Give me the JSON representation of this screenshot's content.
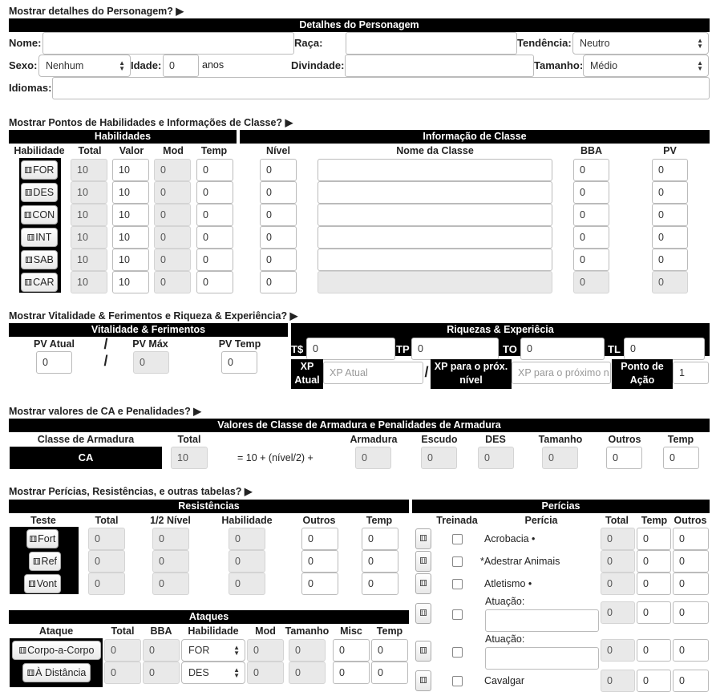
{
  "sections": {
    "details_toggle": "Mostrar detalhes do Personagem?",
    "abilities_toggle": "Mostrar Pontos de Habilidades e Informações de Classe?",
    "vitality_toggle": "Mostrar Vitalidade & Ferimentos e Riqueza & Experiência?",
    "ac_toggle": "Mostrar valores de CA e Penalidades?",
    "skills_toggle": "Mostrar Perícias, Resistências, e outras tabelas?"
  },
  "details": {
    "title": "Detalhes do Personagem",
    "name_label": "Nome:",
    "race_label": "Raça:",
    "alignment_label": "Tendência:",
    "alignment_value": "Neutro",
    "sex_label": "Sexo:",
    "sex_value": "Nenhum",
    "age_label": "Idade:",
    "age_value": "0",
    "age_unit": "anos",
    "deity_label": "Divindade:",
    "size_label": "Tamanho:",
    "size_value": "Médio",
    "languages_label": "Idiomas:"
  },
  "abilities": {
    "title": "Habilidades",
    "headers": [
      "Habilidade",
      "Total",
      "Valor",
      "Mod",
      "Temp"
    ],
    "rows": [
      {
        "name": "FOR",
        "total": "10",
        "value": "10",
        "mod": "0",
        "temp": "0"
      },
      {
        "name": "DES",
        "total": "10",
        "value": "10",
        "mod": "0",
        "temp": "0"
      },
      {
        "name": "CON",
        "total": "10",
        "value": "10",
        "mod": "0",
        "temp": "0"
      },
      {
        "name": "INT",
        "total": "10",
        "value": "10",
        "mod": "0",
        "temp": "0"
      },
      {
        "name": "SAB",
        "total": "10",
        "value": "10",
        "mod": "0",
        "temp": "0"
      },
      {
        "name": "CAR",
        "total": "10",
        "value": "10",
        "mod": "0",
        "temp": "0"
      }
    ]
  },
  "class_info": {
    "title": "Informação de Classe",
    "headers": [
      "Nível",
      "Nome da Classe",
      "BBA",
      "PV"
    ],
    "rows": [
      {
        "level": "0",
        "name": "",
        "bab": "0",
        "hp": "0"
      },
      {
        "level": "0",
        "name": "",
        "bab": "0",
        "hp": "0"
      },
      {
        "level": "0",
        "name": "",
        "bab": "0",
        "hp": "0"
      },
      {
        "level": "0",
        "name": "",
        "bab": "0",
        "hp": "0"
      },
      {
        "level": "0",
        "name": "",
        "bab": "0",
        "hp": "0"
      },
      {
        "level": "0",
        "name": "",
        "bab": "0",
        "hp": "0"
      }
    ]
  },
  "vitality": {
    "title": "Vitalidade & Ferimentos",
    "current_label": "PV Atual",
    "sep": "/",
    "max_label": "PV Máx",
    "temp_label": "PV Temp",
    "current": "0",
    "max": "0",
    "temp": "0"
  },
  "wealth": {
    "title": "Riquezas & Experiêcia",
    "ts_label": "T$",
    "ts": "0",
    "tp_label": "TP",
    "tp": "0",
    "to_label": "TO",
    "to": "0",
    "tl_label": "TL",
    "tl": "0",
    "xp_label": "XP Atual",
    "xp_placeholder": "XP Atual",
    "xp_sep": "/",
    "next_label": "XP para o próx. nível",
    "next_placeholder": "XP para o próximo nível",
    "ap_label": "Ponto de Ação",
    "ap": "1"
  },
  "armor": {
    "title": "Valores de Classe de Armadura e Penalidades de Armadura",
    "headers": [
      "Classe de Armadura",
      "Total",
      "Armadura",
      "Escudo",
      "DES",
      "Tamanho",
      "Outros",
      "Temp"
    ],
    "ca_label": "CA",
    "total": "10",
    "formula": "= 10 + (nível/2) +",
    "armor": "0",
    "shield": "0",
    "dex": "0",
    "size": "0",
    "other": "0",
    "temp": "0"
  },
  "saves": {
    "title": "Resistências",
    "headers": [
      "Teste",
      "Total",
      "1/2 Nível",
      "Habilidade",
      "Outros",
      "Temp"
    ],
    "rows": [
      {
        "name": "Fort",
        "total": "0",
        "half": "0",
        "ability": "0",
        "other": "0",
        "temp": "0"
      },
      {
        "name": "Ref",
        "total": "0",
        "half": "0",
        "ability": "0",
        "other": "0",
        "temp": "0"
      },
      {
        "name": "Vont",
        "total": "0",
        "half": "0",
        "ability": "0",
        "other": "0",
        "temp": "0"
      }
    ]
  },
  "attacks": {
    "title": "Ataques",
    "headers": [
      "Ataque",
      "Total",
      "BBA",
      "Habilidade",
      "Mod",
      "Tamanho",
      "Misc",
      "Temp"
    ],
    "rows": [
      {
        "name": "Corpo-a-Corpo",
        "total": "0",
        "bab": "0",
        "ability": "FOR",
        "mod": "0",
        "size": "0",
        "misc": "0",
        "temp": "0"
      },
      {
        "name": "À Distância",
        "total": "0",
        "bab": "0",
        "ability": "DES",
        "mod": "0",
        "size": "0",
        "misc": "0",
        "temp": "0"
      }
    ]
  },
  "skills": {
    "title": "Perícias",
    "headers": [
      "Treinada",
      "Perícia",
      "Total",
      "Temp",
      "Outros"
    ],
    "rows": [
      {
        "name": "Acrobacia •",
        "total": "0",
        "temp": "0",
        "other": "0"
      },
      {
        "name": "*Adestrar Animais",
        "total": "0",
        "temp": "0",
        "other": "0"
      },
      {
        "name": "Atletismo •",
        "total": "0",
        "temp": "0",
        "other": "0"
      },
      {
        "name": "Atuação:",
        "total": "0",
        "temp": "0",
        "other": "0"
      },
      {
        "name": "Atuação:",
        "total": "0",
        "temp": "0",
        "other": "0"
      },
      {
        "name": "Cavalgar",
        "total": "0",
        "temp": "0",
        "other": "0"
      }
    ]
  }
}
